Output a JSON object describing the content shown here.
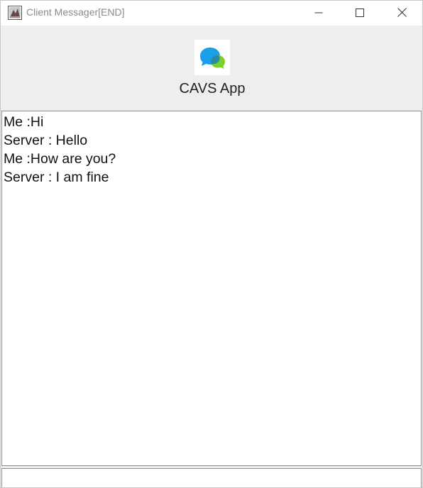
{
  "window": {
    "title": "Client Messager[END]"
  },
  "header": {
    "logo_icon": "chat-bubbles-icon",
    "app_name": "CAVS App"
  },
  "chat": {
    "messages": [
      "Me :Hi",
      "Server : Hello",
      "Me :How are you?",
      "Server : I am fine"
    ]
  },
  "input": {
    "value": ""
  },
  "colors": {
    "header_bg": "#eeeeee",
    "bubble_blue": "#1aa0e8",
    "bubble_green": "#7ccf2c",
    "border": "#8c8c8c"
  }
}
